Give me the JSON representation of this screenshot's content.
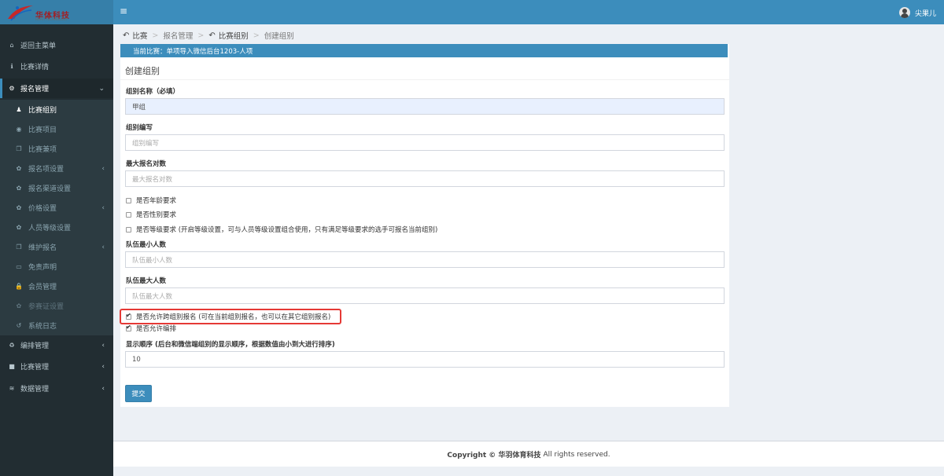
{
  "logo": {
    "text": "华体科技",
    "sub": "HUATI TECHNOLOGY"
  },
  "header": {
    "user_name": "尖果儿"
  },
  "sidebar": {
    "items": [
      {
        "icon": "home-icon",
        "glyph": "⌂",
        "label": "返回主菜单"
      },
      {
        "icon": "info-icon",
        "glyph": "ℹ",
        "label": "比赛详情"
      },
      {
        "icon": "cogs-icon",
        "glyph": "⚙",
        "label": "报名管理",
        "chev": "⌄"
      }
    ],
    "sub_items": [
      {
        "icon": "user-icon",
        "glyph": "♟",
        "label": "比赛组别"
      },
      {
        "icon": "gamepad-icon",
        "glyph": "◉",
        "label": "比赛项目"
      },
      {
        "icon": "copy-icon",
        "glyph": "❐",
        "label": "比赛兼项"
      },
      {
        "icon": "gear-icon",
        "glyph": "✿",
        "label": "报名项设置",
        "chev": "‹"
      },
      {
        "icon": "gear-icon",
        "glyph": "✿",
        "label": "报名渠道设置"
      },
      {
        "icon": "gear-icon",
        "glyph": "✿",
        "label": "价格设置",
        "chev": "‹"
      },
      {
        "icon": "gear-icon",
        "glyph": "✿",
        "label": "人员等级设置"
      },
      {
        "icon": "copy-icon",
        "glyph": "❐",
        "label": "维护报名",
        "chev": "‹"
      },
      {
        "icon": "card-icon",
        "glyph": "▭",
        "label": "免责声明"
      },
      {
        "icon": "lock-icon",
        "glyph": "🔒",
        "label": "会员管理"
      },
      {
        "icon": "gear-icon",
        "glyph": "✿",
        "label": "参赛证设置"
      },
      {
        "icon": "history-icon",
        "glyph": "↺",
        "label": "系统日志"
      }
    ],
    "bottom_items": [
      {
        "icon": "recycle-icon",
        "glyph": "♻",
        "label": "编排管理",
        "chev": "‹"
      },
      {
        "icon": "square-icon",
        "glyph": "■",
        "label": "比赛管理",
        "chev": "‹"
      },
      {
        "icon": "database-icon",
        "glyph": "≋",
        "label": "数据管理",
        "chev": "‹"
      }
    ]
  },
  "breadcrumb": {
    "back1": "比赛",
    "item2": "报名管理",
    "back3": "比赛组别",
    "current": "创建组别"
  },
  "form": {
    "match_bar": "当前比赛：单项导入微信后台1203-人项",
    "box_title": "创建组别",
    "group_name_label": "组别名称（必填）",
    "group_name_value": "甲组",
    "group_code_label": "组别编写",
    "group_code_placeholder": "组别编写",
    "max_pairs_label": "最大报名对数",
    "max_pairs_placeholder": "最大报名对数",
    "age_req": "是否年龄要求",
    "gender_req": "是否性别要求",
    "level_req": "是否等级要求 (开启等级设置，可与人员等级设置组合使用，只有满足等级要求的选手可报名当前组别)",
    "team_min_label": "队伍最小人数",
    "team_min_placeholder": "队伍最小人数",
    "team_max_label": "队伍最大人数",
    "team_max_placeholder": "队伍最大人数",
    "cross_group": "是否允许跨组别报名 (可在当前组别报名，也可以在其它组别报名)",
    "allow_arrange": "是否允许编排",
    "display_order_label": "显示顺序 (后台和微信端组别的显示顺序，根据数值由小到大进行排序)",
    "display_order_value": "10",
    "submit": "提交"
  },
  "footer": {
    "copyright": "Copyright © 华羽体育科技",
    "rights": "All rights reserved."
  }
}
